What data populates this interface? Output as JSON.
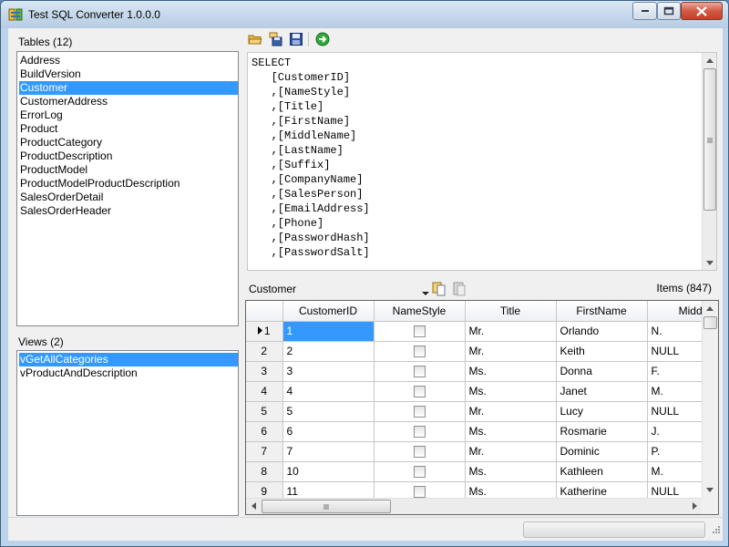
{
  "window": {
    "title": "Test SQL Converter 1.0.0.0",
    "app_icon": "converter-app-icon"
  },
  "tables": {
    "label": "Tables (12)",
    "items": [
      "Address",
      "BuildVersion",
      "Customer",
      "CustomerAddress",
      "ErrorLog",
      "Product",
      "ProductCategory",
      "ProductDescription",
      "ProductModel",
      "ProductModelProductDescription",
      "SalesOrderDetail",
      "SalesOrderHeader"
    ],
    "selected": "Customer"
  },
  "views": {
    "label": "Views (2)",
    "items": [
      "vGetAllCategories",
      "vProductAndDescription"
    ],
    "selected": "vGetAllCategories"
  },
  "toolbar": {
    "icons": [
      "open-folder-icon",
      "save-as-icon",
      "save-icon",
      "run-arrow-icon"
    ]
  },
  "sql": {
    "lines": [
      "SELECT",
      "   [CustomerID]",
      "   ,[NameStyle]",
      "   ,[Title]",
      "   ,[FirstName]",
      "   ,[MiddleName]",
      "   ,[LastName]",
      "   ,[Suffix]",
      "   ,[CompanyName]",
      "   ,[SalesPerson]",
      "   ,[EmailAddress]",
      "   ,[Phone]",
      "   ,[PasswordHash]",
      "   ,[PasswordSalt]"
    ]
  },
  "data_panel": {
    "combo_value": "Customer",
    "items_label": "Items (847)",
    "icons": [
      "copy-icon",
      "paste-icon"
    ]
  },
  "grid": {
    "columns": [
      "",
      "CustomerID",
      "NameStyle",
      "Title",
      "FirstName",
      "MiddleNa"
    ],
    "rows": [
      {
        "row": "1",
        "id": "1",
        "title": "Mr.",
        "first": "Orlando",
        "middle": "N.",
        "current": true
      },
      {
        "row": "2",
        "id": "2",
        "title": "Mr.",
        "first": "Keith",
        "middle": "NULL"
      },
      {
        "row": "3",
        "id": "3",
        "title": "Ms.",
        "first": "Donna",
        "middle": "F."
      },
      {
        "row": "4",
        "id": "4",
        "title": "Ms.",
        "first": "Janet",
        "middle": "M."
      },
      {
        "row": "5",
        "id": "5",
        "title": "Mr.",
        "first": "Lucy",
        "middle": "NULL"
      },
      {
        "row": "6",
        "id": "6",
        "title": "Ms.",
        "first": "Rosmarie",
        "middle": "J."
      },
      {
        "row": "7",
        "id": "7",
        "title": "Mr.",
        "first": "Dominic",
        "middle": "P."
      },
      {
        "row": "8",
        "id": "10",
        "title": "Ms.",
        "first": "Kathleen",
        "middle": "M."
      },
      {
        "row": "9",
        "id": "11",
        "title": "Ms.",
        "first": "Katherine",
        "middle": "NULL"
      }
    ]
  },
  "colors": {
    "selection": "#3399ff",
    "title_gradient_top": "#dbe8f5",
    "close_button": "#c4402a"
  }
}
